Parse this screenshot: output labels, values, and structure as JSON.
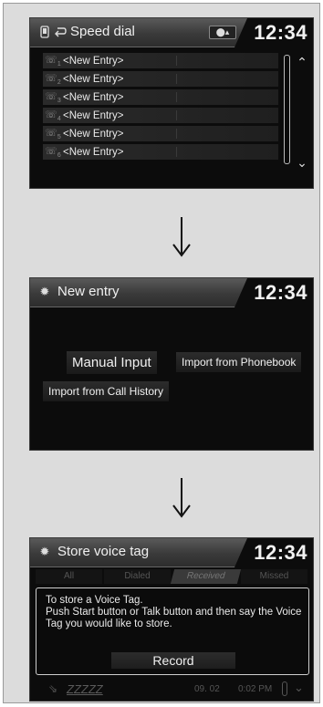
{
  "speed_dial": {
    "title": "Speed dial",
    "clock": "12:34",
    "entries": [
      {
        "num": "1",
        "label": "<New Entry>"
      },
      {
        "num": "2",
        "label": "<New Entry>"
      },
      {
        "num": "3",
        "label": "<New Entry>"
      },
      {
        "num": "4",
        "label": "<New Entry>"
      },
      {
        "num": "5",
        "label": "<New Entry>"
      },
      {
        "num": "6",
        "label": "<New Entry>"
      }
    ]
  },
  "new_entry": {
    "title": "New entry",
    "clock": "12:34",
    "manual_input": "Manual Input",
    "import_phonebook": "Import from Phonebook",
    "import_call_history": "Import from Call History"
  },
  "voice_tag": {
    "title": "Store voice tag",
    "clock": "12:34",
    "tabs": [
      "All",
      "Dialed",
      "Received",
      "Missed"
    ],
    "message": "To store a Voice Tag.\nPush Start button or Talk button and then say the Voice Tag you would like to store.",
    "record_label": "Record",
    "bottom_name": "ZZZZZ",
    "bottom_date": "09. 02",
    "bottom_time": "0:02 PM"
  }
}
